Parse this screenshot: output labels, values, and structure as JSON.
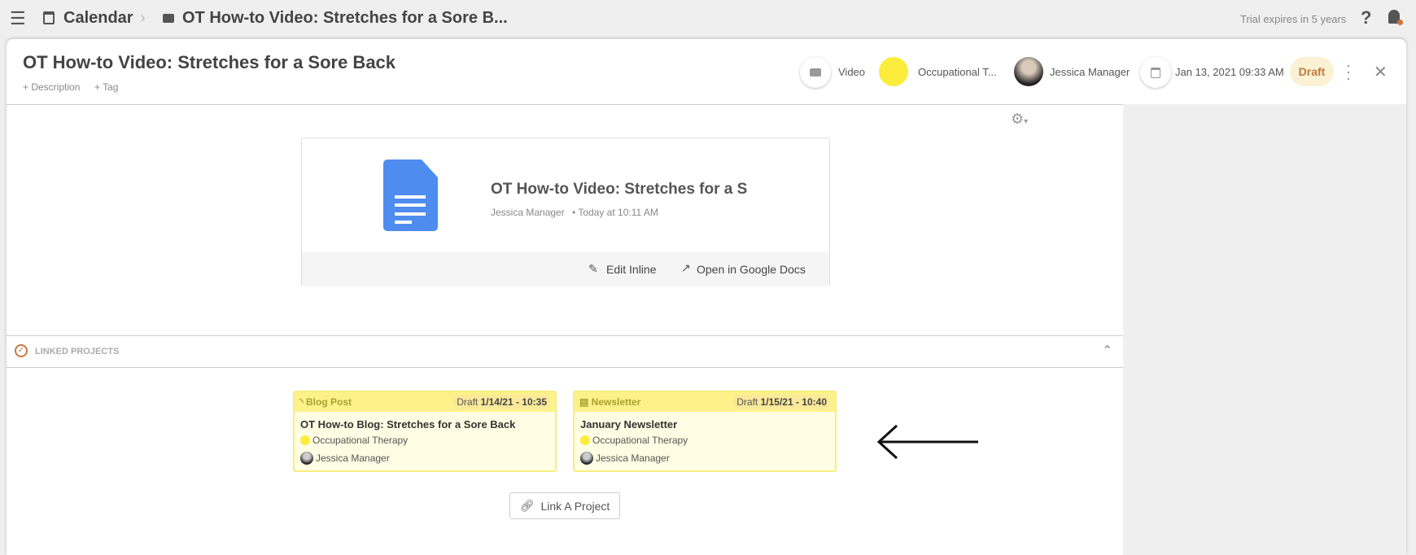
{
  "topbar": {
    "menu_icon": "hamburger-icon",
    "calendar_label": "Calendar",
    "breadcrumb_title": "OT How-to Video: Stretches for a Sore B...",
    "trial": "Trial expires in 5 years",
    "help": "?"
  },
  "header": {
    "title": "OT How-to Video: Stretches for a Sore Back",
    "add_description": "+ Description",
    "add_tag": "+ Tag",
    "type": "Video",
    "category": "Occupational T...",
    "category_color": "#fcec3c",
    "owner": "Jessica Manager",
    "date": "Jan 13, 2021 09:33 AM",
    "status": "Draft"
  },
  "doc": {
    "title": "OT How-to Video: Stretches for a S",
    "author": "Jessica Manager",
    "time": "• Today at 10:11 AM",
    "edit_inline": "Edit Inline",
    "open_docs": "Open in Google Docs"
  },
  "linked": {
    "heading": "LINKED PROJECTS",
    "link_button": "Link A Project",
    "projects": [
      {
        "type": "Blog Post",
        "status": "Draft",
        "date": "1/14/21 - 10:35",
        "title": "OT How-to Blog: Stretches for a Sore Back",
        "category": "Occupational Therapy",
        "owner": "Jessica Manager"
      },
      {
        "type": "Newsletter",
        "status": "Draft",
        "date": "1/15/21 - 10:40",
        "title": "January Newsletter",
        "category": "Occupational Therapy",
        "owner": "Jessica Manager"
      }
    ]
  }
}
